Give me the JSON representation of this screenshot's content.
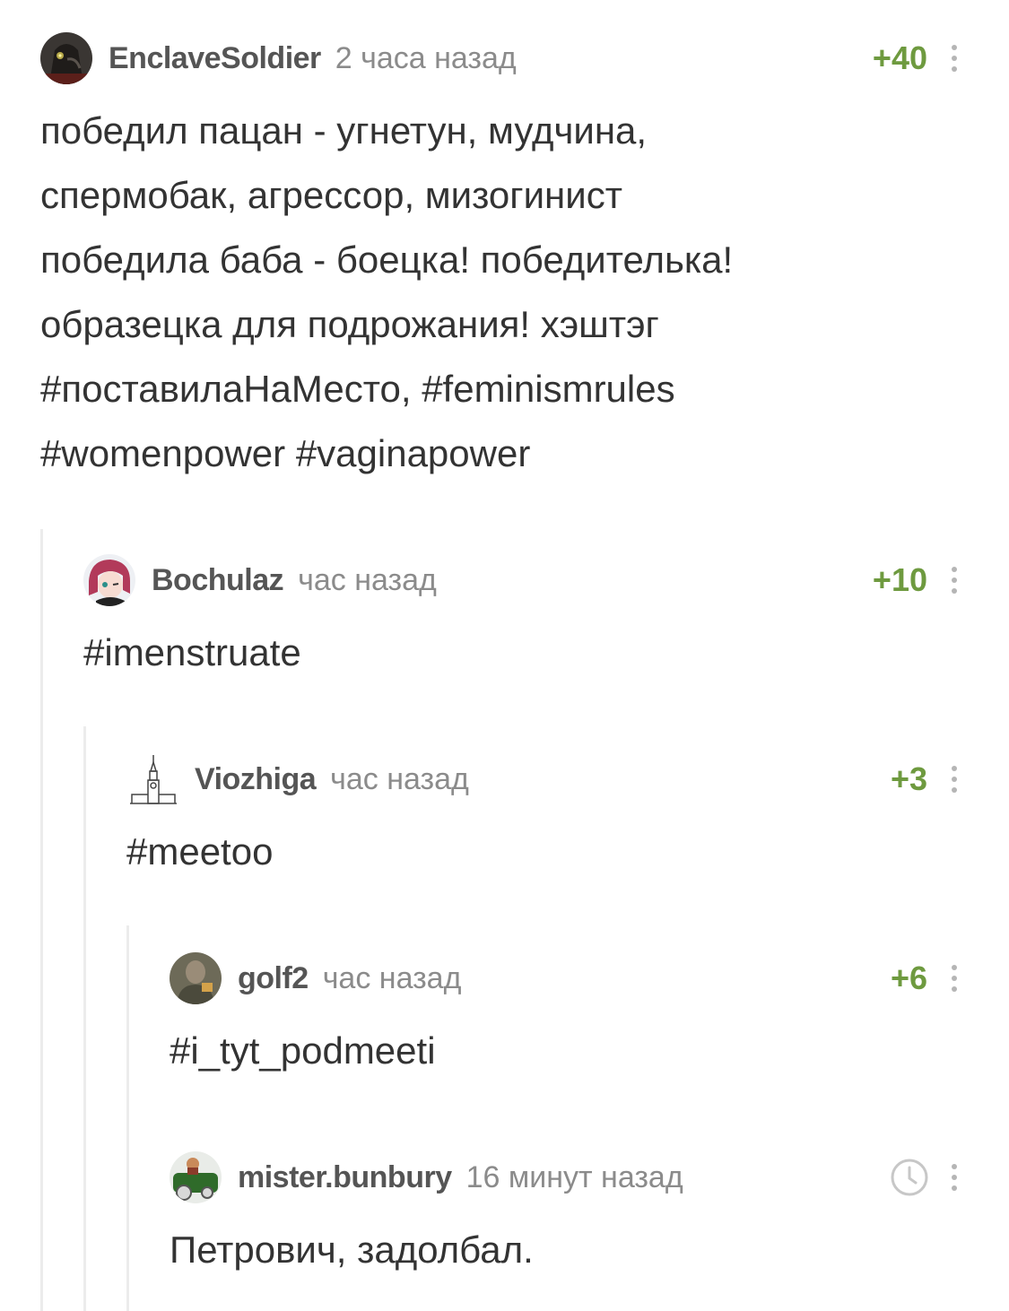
{
  "comments": [
    {
      "username": "EnclaveSoldier",
      "time": "2 часа назад",
      "rating": "+40",
      "text": "победил пацан - угнетун, мудчина,\nспермобак, агрессор, мизогинист\nпобедила баба - боецка! победителька!\nобразецка для подрожания! хэштэг\n#поставилаНаМесто, #feminismrules\n#womenpower #vaginapower"
    },
    {
      "username": "Bochulaz",
      "time": "час назад",
      "rating": "+10",
      "text": "#imenstruate"
    },
    {
      "username": "Viozhiga",
      "time": "час назад",
      "rating": "+3",
      "text": "#meetoo"
    },
    {
      "username": "golf2",
      "time": "час назад",
      "rating": "+6",
      "text": "#i_tyt_podmeeti"
    },
    {
      "username": "mister.bunbury",
      "time": "16 минут назад",
      "rating_icon": "clock-icon",
      "text": "Петрович, задолбал."
    }
  ],
  "colors": {
    "rating": "#6e9a3f",
    "username": "#555555",
    "time": "#8b8b8b",
    "text": "#333333",
    "thread_line": "#ececec"
  }
}
